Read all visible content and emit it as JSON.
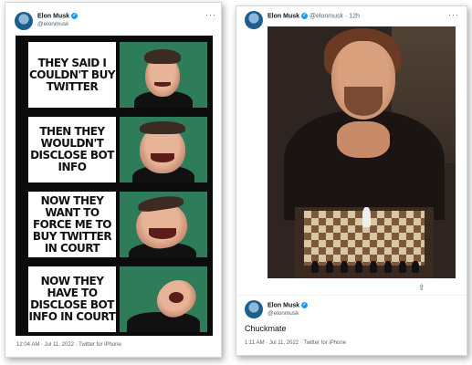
{
  "left_tweet": {
    "name": "Elon Musk",
    "handle": "@elonmusk",
    "panels": [
      {
        "text": "THEY SAID I COULDN'T BUY TWITTER"
      },
      {
        "text": "THEN THEY WOULDN'T DISCLOSE BOT INFO"
      },
      {
        "text": "NOW THEY WANT TO FORCE ME TO BUY TWITTER IN COURT"
      },
      {
        "text": "NOW THEY HAVE TO DISCLOSE BOT INFO IN COURT"
      }
    ],
    "timestamp": "12:04 AM · Jul 11, 2022 · Twitter for iPhone"
  },
  "right_tweet": {
    "name": "Elon Musk",
    "handle": "@elonmusk",
    "time_ago": "· 12h",
    "reply_name": "Elon Musk",
    "reply_handle": "@elonmusk",
    "text": "Chuckmate",
    "timestamp": "1:11 AM · Jul 11, 2022 · Twitter for iPhone"
  },
  "icons": {
    "verified": "verified-badge-icon",
    "more": "more-options-icon",
    "share": "share-icon"
  },
  "colors": {
    "verified_blue": "#1d9bf0",
    "meme_green": "#2f7c5b",
    "secondary_text": "#536471"
  }
}
